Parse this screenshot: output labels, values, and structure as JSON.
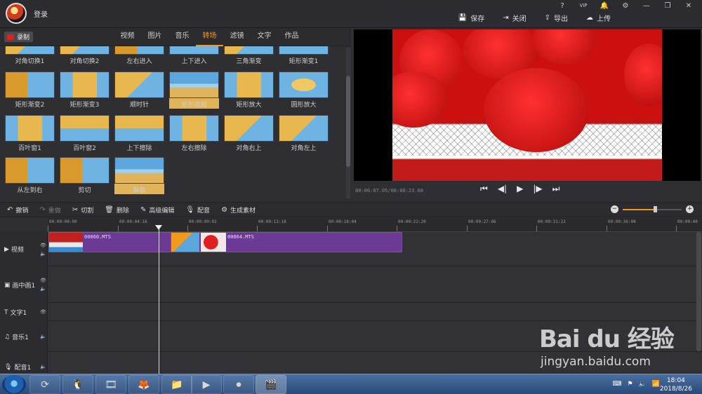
{
  "header": {
    "login_label": "登录",
    "window_controls": [
      "?",
      "VIP",
      "🔔",
      "⚙",
      "—",
      "❐",
      "✕"
    ],
    "actions": [
      {
        "icon": "save-icon",
        "glyph": "💾",
        "label": "保存"
      },
      {
        "icon": "close-project-icon",
        "glyph": "⇥",
        "label": "关闭"
      },
      {
        "icon": "export-icon",
        "glyph": "⇪",
        "label": "导出"
      },
      {
        "icon": "upload-icon",
        "glyph": "☁",
        "label": "上传"
      }
    ]
  },
  "library": {
    "record_label": "录制",
    "tabs": [
      "视频",
      "图片",
      "音乐",
      "转场",
      "滤镜",
      "文字",
      "作品"
    ],
    "active_tab": "转场",
    "rows": [
      [
        "对角切换1",
        "对角切换2",
        "左右进入",
        "上下进入",
        "三角渐变",
        "矩形渐变1"
      ],
      [
        "矩形渐变2",
        "矩形渐变3",
        "顺时针",
        "矩形收缩",
        "矩形放大",
        "圆形放大"
      ],
      [
        "百叶窗1",
        "百叶窗2",
        "上下擦除",
        "左右擦除",
        "对角右上",
        "对角左上"
      ],
      [
        "从左到右",
        "剪切",
        "解散"
      ]
    ]
  },
  "preview": {
    "time_readout": "00:00:07.05/00:00:23.00",
    "controls": [
      {
        "name": "skip-start-icon",
        "glyph": "⏮"
      },
      {
        "name": "step-back-icon",
        "glyph": "◀|"
      },
      {
        "name": "play-icon",
        "glyph": "▶"
      },
      {
        "name": "step-forward-icon",
        "glyph": "|▶"
      },
      {
        "name": "skip-end-icon",
        "glyph": "⏭"
      }
    ]
  },
  "toolbar": {
    "buttons": [
      {
        "name": "undo",
        "glyph": "↶",
        "label": "撤销",
        "enabled": true
      },
      {
        "name": "redo",
        "glyph": "↷",
        "label": "重做",
        "enabled": false
      },
      {
        "name": "cut",
        "glyph": "✂",
        "label": "切割",
        "enabled": true
      },
      {
        "name": "delete",
        "glyph": "🗑",
        "label": "删除",
        "enabled": true
      },
      {
        "name": "advanced-edit",
        "glyph": "✎",
        "label": "高级编辑",
        "enabled": true
      },
      {
        "name": "dub",
        "glyph": "🎙",
        "label": "配音",
        "enabled": true
      },
      {
        "name": "generate-material",
        "glyph": "⚙",
        "label": "生成素材",
        "enabled": true
      }
    ],
    "zoom_level": 0.55
  },
  "timeline": {
    "ruler_ticks": [
      "00:00:00:00",
      "00:00:04:16",
      "00:00:09:02",
      "00:00:13:18",
      "00:00:18:04",
      "00:00:22:20",
      "00:00:27:06",
      "00:00:31:22",
      "00:00:36:08",
      "00:00:40"
    ],
    "tracks": [
      {
        "name": "video",
        "icon": "▶",
        "label": "视频"
      },
      {
        "name": "pip",
        "icon": "▣",
        "label": "画中画1"
      },
      {
        "name": "text",
        "icon": "T",
        "label": "文字1"
      },
      {
        "name": "music",
        "icon": "♫",
        "label": "音乐1"
      },
      {
        "name": "voice",
        "icon": "🎙",
        "label": "配音1"
      }
    ],
    "clips": [
      "00060.MTS",
      "00064.MTS"
    ]
  },
  "taskbar": {
    "apps": [
      "⟳",
      "🐧",
      "🎞",
      "🦊",
      "📁",
      "▶",
      "⏺",
      "🎬"
    ],
    "clock_time": "18:04",
    "clock_date": "2018/8/26"
  },
  "watermark": {
    "logo": "Bai du 经验",
    "url": "jingyan.baidu.com"
  },
  "colors": {
    "accent": "#f39a1e",
    "clip": "#6a3a94",
    "record": "#e02020"
  }
}
